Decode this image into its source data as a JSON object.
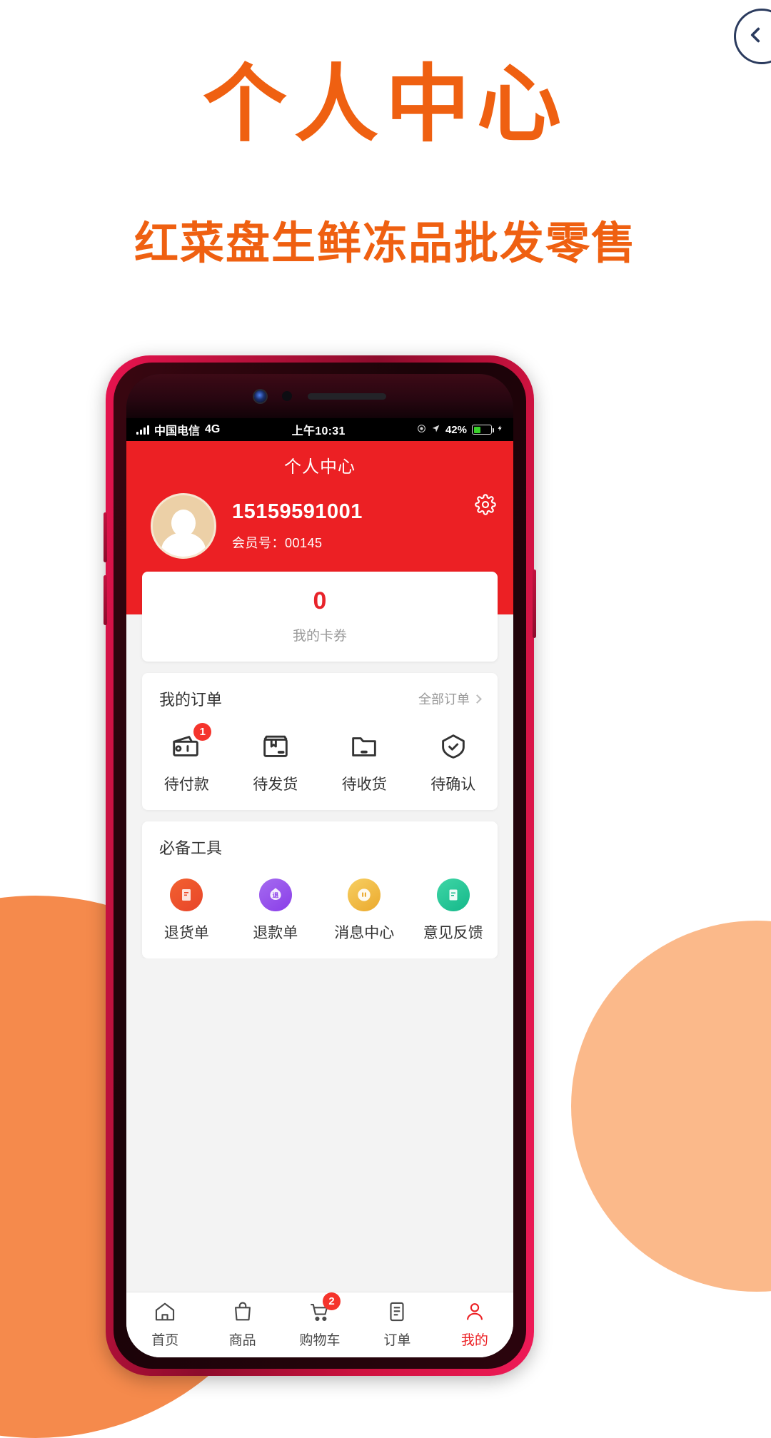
{
  "promo": {
    "title": "个人中心",
    "subtitle": "红菜盘生鲜冻品批发零售",
    "accent_color": "#ef6011"
  },
  "back_button": {
    "name": "back-arrow"
  },
  "phone": {
    "statusbar": {
      "carrier": "中国电信",
      "network": "4G",
      "time": "上午10:31",
      "battery_percent": "42%",
      "signal_icon": "signal-bars-icon",
      "location_icon": "location-icon",
      "nav_icon": "navigation-icon",
      "battery_icon": "battery-icon",
      "charging_icon": "charging-bolt-icon"
    },
    "header": {
      "title": "个人中心",
      "settings_icon": "gear-icon",
      "bg_color": "#ec2024"
    },
    "profile": {
      "avatar_icon": "avatar-placeholder-icon",
      "phone": "15159591001",
      "member_label": "会员号：",
      "member_id": "00145"
    },
    "coupon": {
      "count": "0",
      "label": "我的卡券"
    },
    "orders": {
      "title": "我的订单",
      "more_label": "全部订单",
      "more_icon": "chevron-right-icon",
      "items": [
        {
          "label": "待付款",
          "icon": "wallet-icon",
          "badge": "1"
        },
        {
          "label": "待发货",
          "icon": "package-box-icon",
          "badge": ""
        },
        {
          "label": "待收货",
          "icon": "folder-icon",
          "badge": ""
        },
        {
          "label": "待确认",
          "icon": "check-shield-icon",
          "badge": ""
        }
      ]
    },
    "tools": {
      "title": "必备工具",
      "items": [
        {
          "label": "退货单",
          "icon": "return-order-icon",
          "glyph": "≡",
          "color": "#ec4a2a"
        },
        {
          "label": "退款单",
          "icon": "refund-bag-icon",
          "glyph": "退",
          "color": "#8a3ee8"
        },
        {
          "label": "消息中心",
          "icon": "message-center-icon",
          "glyph": "〃",
          "color": "#eba92d"
        },
        {
          "label": "意见反馈",
          "icon": "feedback-icon",
          "glyph": "☰",
          "color": "#15b88a"
        }
      ]
    },
    "tabbar": {
      "items": [
        {
          "label": "首页",
          "icon": "home-icon",
          "badge": "",
          "active": false
        },
        {
          "label": "商品",
          "icon": "goods-bag-icon",
          "badge": "",
          "active": false
        },
        {
          "label": "购物车",
          "icon": "cart-icon",
          "badge": "2",
          "active": false
        },
        {
          "label": "订单",
          "icon": "order-list-icon",
          "badge": "",
          "active": false
        },
        {
          "label": "我的",
          "icon": "user-icon",
          "badge": "",
          "active": true
        }
      ],
      "active_color": "#ec2024"
    }
  }
}
